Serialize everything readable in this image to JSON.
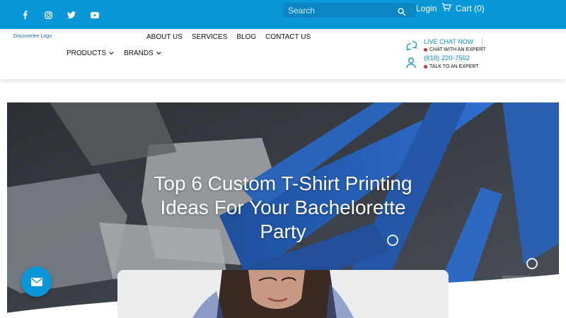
{
  "topbar": {
    "social": [
      {
        "name": "facebook-icon"
      },
      {
        "name": "instagram-icon"
      },
      {
        "name": "twitter-icon"
      },
      {
        "name": "youtube-icon"
      }
    ],
    "search_placeholder": "Search",
    "login_label": "Login",
    "cart_label": "Cart (0)"
  },
  "header": {
    "logo_text": "Discoverlee Logo",
    "nav_top": [
      "ABOUT US",
      "SERVICES",
      "BLOG",
      "CONTACT US"
    ],
    "nav_bottom": [
      "PRODUCTS",
      "BRANDS"
    ],
    "contact": {
      "live_chat": "LIVE CHAT NOW",
      "chat_expert": "CHAT WITH AN EXPERT",
      "phone": "(818) 220-7502",
      "talk_expert": "TALK TO AN EXPERT"
    }
  },
  "hero": {
    "title": "Top 6 Custom T-Shirt Printing Ideas For Your Bachelorette Party"
  },
  "colors": {
    "brand_blue": "#0a97d9",
    "search_bg": "#0c86c3",
    "link_blue": "#0a8fd0",
    "status_red": "#d32f2f"
  }
}
